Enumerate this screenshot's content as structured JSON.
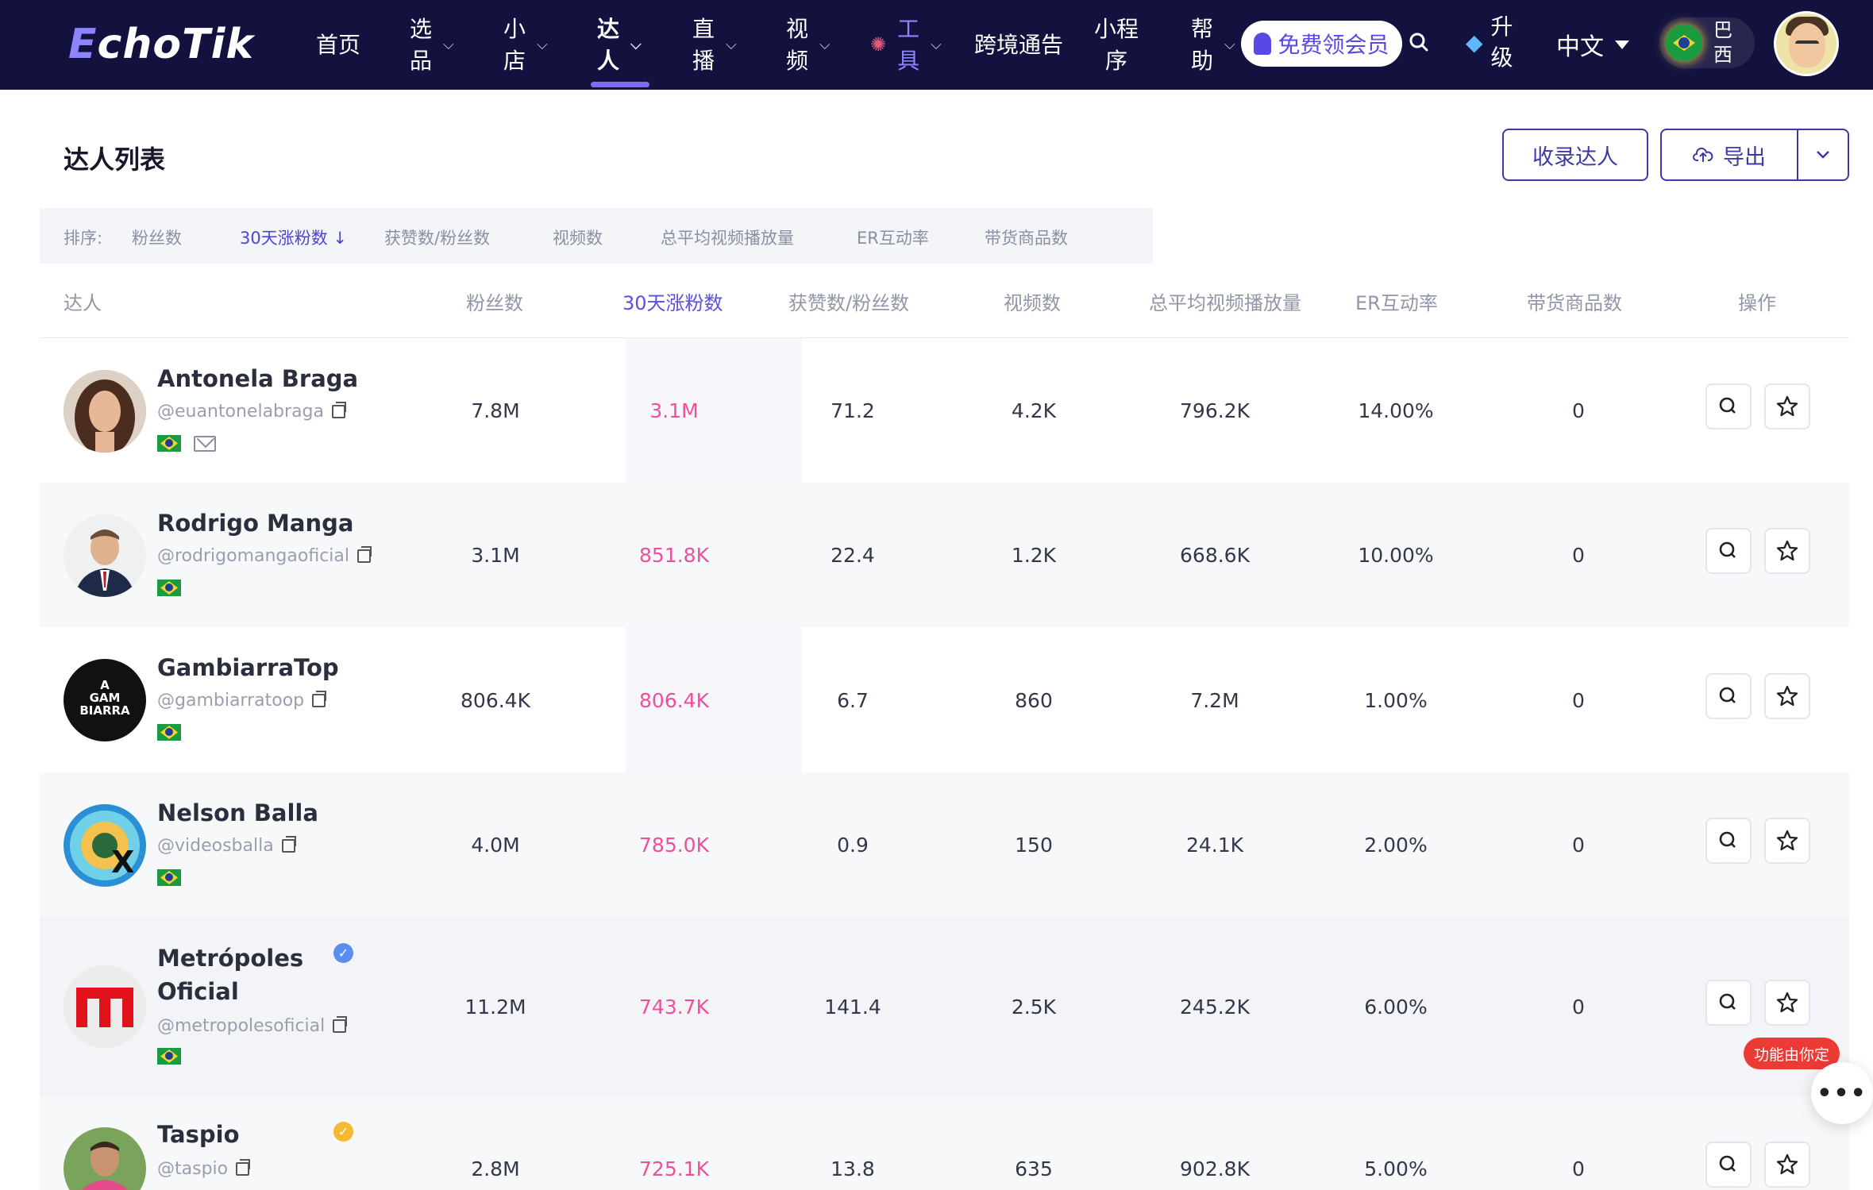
{
  "brand": {
    "logo_prefix": "E",
    "logo_rest": "choTik"
  },
  "nav": {
    "home": "首页",
    "select_1": "选",
    "select_2": "品",
    "shop_1": "小",
    "shop_2": "店",
    "influencer_1": "达",
    "influencer_2": "人",
    "live_1": "直",
    "live_2": "播",
    "video_1": "视",
    "video_2": "频",
    "tools_1": "工",
    "tools_2": "具",
    "crossborder": "跨境通告",
    "mini_1": "小程",
    "mini_2": "序",
    "help_1": "帮",
    "help_2": "助",
    "free_member": "免费领会员",
    "upgrade_1": "升",
    "upgrade_2": "级",
    "language": "中文",
    "region_1": "巴",
    "region_2": "西"
  },
  "page": {
    "title": "达人列表",
    "collect_button": "收录达人",
    "export_button": "导出"
  },
  "sortbar": {
    "label": "排序:",
    "options": [
      "粉丝数",
      "30天涨粉数 ↓",
      "获赞数/粉丝数",
      "视频数",
      "总平均视频播放量",
      "ER互动率",
      "带货商品数"
    ]
  },
  "table": {
    "headers": [
      "达人",
      "粉丝数",
      "30天涨粉数",
      "获赞数/粉丝数",
      "视频数",
      "总平均视频播放量",
      "ER互动率",
      "带货商品数",
      "操作"
    ],
    "rows": [
      {
        "name": "Antonela Braga",
        "handle": "@euantonelabraga",
        "followers": "7.8M",
        "growth_30d": "3.1M",
        "likes_ratio": "71.2",
        "videos": "4.2K",
        "avg_views": "796.2K",
        "er": "14.00%",
        "products": "0"
      },
      {
        "name": "Rodrigo Manga",
        "handle": "@rodrigomangaoficial",
        "followers": "3.1M",
        "growth_30d": "851.8K",
        "likes_ratio": "22.4",
        "videos": "1.2K",
        "avg_views": "668.6K",
        "er": "10.00%",
        "products": "0"
      },
      {
        "name": "GambiarraTop",
        "handle": "@gambiarratoop",
        "followers": "806.4K",
        "growth_30d": "806.4K",
        "likes_ratio": "6.7",
        "videos": "860",
        "avg_views": "7.2M",
        "er": "1.00%",
        "products": "0"
      },
      {
        "name": "Nelson Balla",
        "handle": "@videosballa",
        "followers": "4.0M",
        "growth_30d": "785.0K",
        "likes_ratio": "0.9",
        "videos": "150",
        "avg_views": "24.1K",
        "er": "2.00%",
        "products": "0"
      },
      {
        "name_1": "Metrópoles",
        "name_2": "Oficial",
        "handle": "@metropolesoficial",
        "followers": "11.2M",
        "growth_30d": "743.7K",
        "likes_ratio": "141.4",
        "videos": "2.5K",
        "avg_views": "245.2K",
        "er": "6.00%",
        "products": "0"
      },
      {
        "name": "Taspio",
        "handle": "@taspio",
        "followers": "2.8M",
        "growth_30d": "725.1K",
        "likes_ratio": "13.8",
        "videos": "635",
        "avg_views": "902.8K",
        "er": "5.00%",
        "products": "0"
      }
    ]
  },
  "gambiarra_logo": {
    "line1": "A",
    "line2": "GAM",
    "line3": "BIARRA"
  },
  "floating": {
    "tag": "功能由你定",
    "more": "•••"
  },
  "colors": {
    "nav_bg": "#13123f",
    "accent": "#5b4fe6",
    "pink": "#ee4f9c",
    "verified_blue": "#5b8def",
    "verified_gold": "#f5b82e"
  }
}
